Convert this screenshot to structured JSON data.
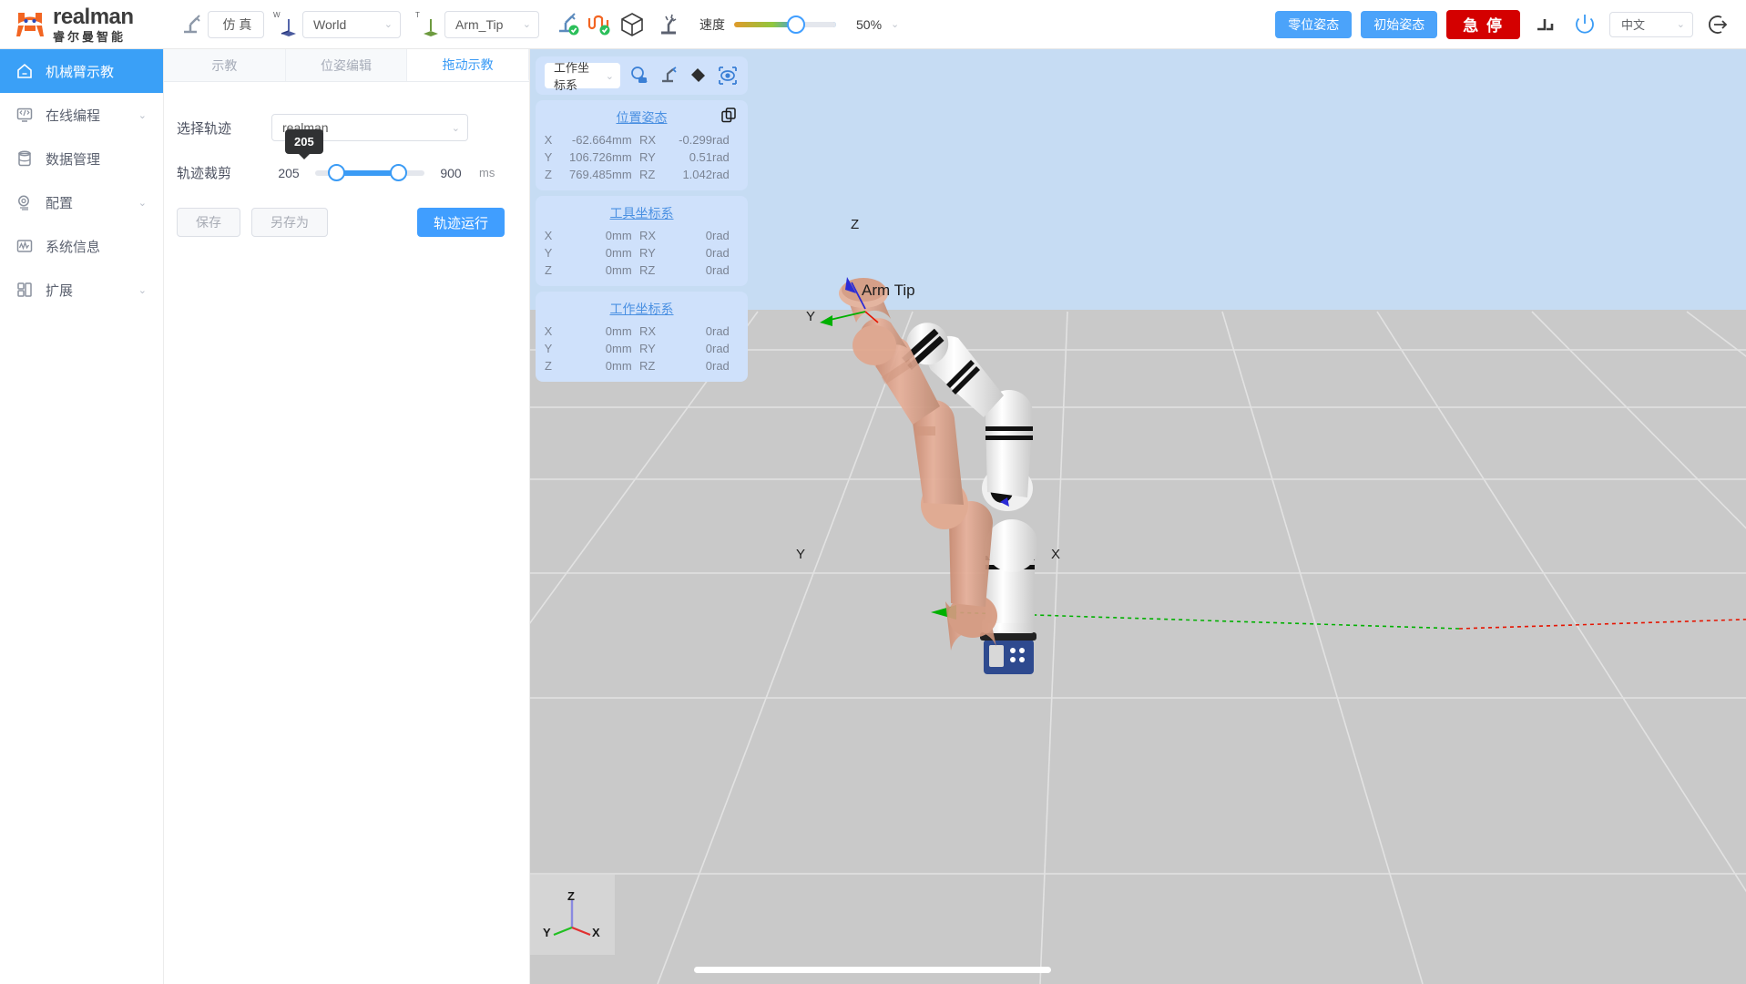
{
  "brand": {
    "name_en": "realman",
    "name_cn": "睿尔曼智能"
  },
  "toolbar": {
    "robot_icon": "robot-arm-icon",
    "sim_button": "仿 真",
    "world_frame_icon": "world-axis-icon",
    "world_frame": "World",
    "tool_frame_icon": "tool-axis-icon",
    "tool_frame": "Arm_Tip",
    "teach_icon": "teach-pendant-icon",
    "cable_icon": "cable-link-icon",
    "box_icon": "bounding-box-icon",
    "drag_icon": "drag-teach-icon",
    "speed_label": "速度",
    "zoom_value": "50%",
    "zero_pose_button": "零位姿态",
    "init_pose_button": "初始姿态",
    "estop_button": "急 停",
    "joint_icon": "joint-limit-icon",
    "power_icon": "power-icon",
    "language": "中文",
    "logout_icon": "logout-icon"
  },
  "sidebar": {
    "items": [
      {
        "label": "机械臂示教",
        "icon": "home-icon",
        "active": true,
        "expandable": false
      },
      {
        "label": "在线编程",
        "icon": "code-monitor-icon",
        "active": false,
        "expandable": true
      },
      {
        "label": "数据管理",
        "icon": "database-icon",
        "active": false,
        "expandable": false
      },
      {
        "label": "配置",
        "icon": "gear-icon",
        "active": false,
        "expandable": true
      },
      {
        "label": "系统信息",
        "icon": "waveform-icon",
        "active": false,
        "expandable": false
      },
      {
        "label": "扩展",
        "icon": "grid-blocks-icon",
        "active": false,
        "expandable": true
      }
    ]
  },
  "panel": {
    "tabs": [
      {
        "label": "示教",
        "active": false
      },
      {
        "label": "位姿编辑",
        "active": false
      },
      {
        "label": "拖动示教",
        "active": true
      }
    ],
    "trajectory_label": "选择轨迹",
    "trajectory_value": "realman",
    "trim_label": "轨迹裁剪",
    "trim_min": "205",
    "trim_max": "900",
    "trim_unit": "ms",
    "trim_tooltip": "205",
    "save_button": "保存",
    "save_as_button": "另存为",
    "run_button": "轨迹运行"
  },
  "hud": {
    "frame_select": "工作坐标系",
    "icons": [
      "inspect-point-icon",
      "teach-robot-icon",
      "eraser-icon",
      "visibility-eye-icon"
    ],
    "copy_icon": "copy-icon",
    "cards": [
      {
        "title": "位置姿态",
        "has_copy": true,
        "rows": [
          {
            "axis": "X",
            "value": "-62.664",
            "unit": "mm",
            "raxis": "RX",
            "rvalue": "-0.299",
            "runit": "rad"
          },
          {
            "axis": "Y",
            "value": "106.726",
            "unit": "mm",
            "raxis": "RY",
            "rvalue": "0.51",
            "runit": "rad"
          },
          {
            "axis": "Z",
            "value": "769.485",
            "unit": "mm",
            "raxis": "RZ",
            "rvalue": "1.042",
            "runit": "rad"
          }
        ]
      },
      {
        "title": "工具坐标系",
        "has_copy": false,
        "rows": [
          {
            "axis": "X",
            "value": "0",
            "unit": "mm",
            "raxis": "RX",
            "rvalue": "0",
            "runit": "rad"
          },
          {
            "axis": "Y",
            "value": "0",
            "unit": "mm",
            "raxis": "RY",
            "rvalue": "0",
            "runit": "rad"
          },
          {
            "axis": "Z",
            "value": "0",
            "unit": "mm",
            "raxis": "RZ",
            "rvalue": "0",
            "runit": "rad"
          }
        ]
      },
      {
        "title": "工作坐标系",
        "has_copy": false,
        "rows": [
          {
            "axis": "X",
            "value": "0",
            "unit": "mm",
            "raxis": "RX",
            "rvalue": "0",
            "runit": "rad"
          },
          {
            "axis": "Y",
            "value": "0",
            "unit": "mm",
            "raxis": "RY",
            "rvalue": "0",
            "runit": "rad"
          },
          {
            "axis": "Z",
            "value": "0",
            "unit": "mm",
            "raxis": "RZ",
            "rvalue": "0",
            "runit": "rad"
          }
        ]
      }
    ]
  },
  "viewport": {
    "tcp_label": "Arm Tip",
    "tcp_axis_z": "Z",
    "tcp_axis_y": "Y",
    "world_axis_x": "X",
    "world_axis_y": "Y",
    "world_axis_z": "Z",
    "gizmo": {
      "x": "X",
      "y": "Y",
      "z": "Z"
    }
  },
  "colors": {
    "accent": "#3a9bf5",
    "danger": "#d40000",
    "brand_orange": "#f26522",
    "hud_bg": "#cfe1fb",
    "axis_x": "#e51400",
    "axis_y": "#00c000",
    "axis_z": "#2b2bd6"
  }
}
